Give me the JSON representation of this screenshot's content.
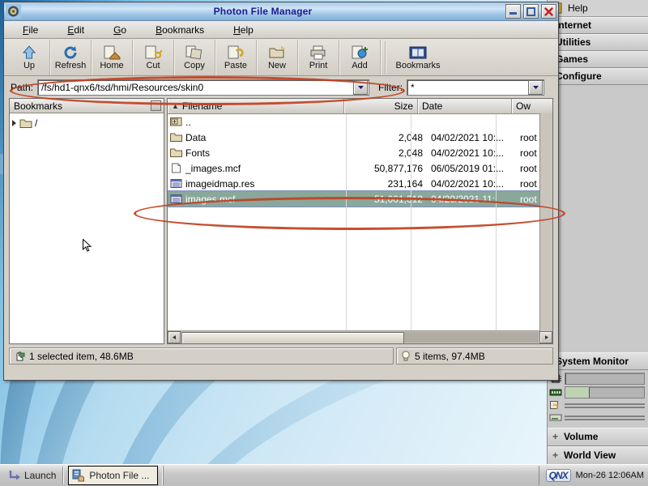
{
  "desktop": {
    "taskbar": {
      "launch_label": "Launch",
      "task_label": "Photon File ...",
      "brand": "QNX",
      "clock": "Mon-26 12:06AM"
    },
    "shelf": {
      "help_label": "Help",
      "groups": [
        "Internet",
        "Utilities",
        "Games",
        "Configure"
      ],
      "system_monitor": {
        "title": "System Monitor",
        "gauges": [
          {
            "icon": "cpu-icon",
            "percent": 0,
            "thin": false
          },
          {
            "icon": "memory-icon",
            "percent": 30,
            "thin": false
          },
          {
            "icon": "disk-icon",
            "percent": 0,
            "thin": true
          },
          {
            "icon": "disk-icon",
            "percent": 0,
            "thin": true
          },
          {
            "icon": "network-icon",
            "percent": 0,
            "thin": true
          },
          {
            "icon": "network-icon",
            "percent": 0,
            "thin": true
          }
        ]
      },
      "expanders": [
        "Volume",
        "World View"
      ]
    }
  },
  "window": {
    "title": "Photon File Manager",
    "controls": {
      "minimize": "minimize-button",
      "maximize": "maximize-button",
      "close": "close-button"
    },
    "menu": [
      {
        "label": "File",
        "accel": "F"
      },
      {
        "label": "Edit",
        "accel": "E"
      },
      {
        "label": "Go",
        "accel": "G"
      },
      {
        "label": "Bookmarks",
        "accel": "B"
      },
      {
        "label": "Help",
        "accel": "H"
      }
    ],
    "toolbar": [
      {
        "label": "Up",
        "icon": "up-arrow-icon"
      },
      {
        "label": "Refresh",
        "icon": "refresh-icon"
      },
      {
        "label": "Home",
        "icon": "home-icon"
      },
      {
        "label": "Cut",
        "icon": "cut-icon"
      },
      {
        "label": "Copy",
        "icon": "copy-icon"
      },
      {
        "label": "Paste",
        "icon": "paste-icon"
      },
      {
        "label": "New",
        "icon": "new-folder-icon"
      },
      {
        "label": "Print",
        "icon": "print-icon"
      },
      {
        "label": "Add",
        "icon": "add-bookmark-icon"
      },
      {
        "label": "Bookmarks",
        "icon": "bookmarks-book-icon"
      }
    ],
    "path": {
      "label": "Path:",
      "value": "/fs/hd1-qnx6/tsd/hmi/Resources/skin0"
    },
    "filter": {
      "label": "Filter:",
      "value": "*"
    },
    "bookmarks_pane": {
      "title": "Bookmarks",
      "root_label": "/"
    },
    "file_list": {
      "columns": [
        {
          "key": "name",
          "label": "Filename",
          "sorted": true
        },
        {
          "key": "size",
          "label": "Size"
        },
        {
          "key": "date",
          "label": "Date"
        },
        {
          "key": "owner",
          "label": "Ow"
        }
      ],
      "rows": [
        {
          "name": "..",
          "icon": "parent-folder-icon",
          "size": "",
          "date": "",
          "owner": "",
          "selected": false
        },
        {
          "name": "Data",
          "icon": "folder-icon",
          "size": "2,048",
          "date": "04/02/2021 10:...",
          "owner": "root",
          "selected": false
        },
        {
          "name": "Fonts",
          "icon": "folder-icon",
          "size": "2,048",
          "date": "04/02/2021 10:...",
          "owner": "root",
          "selected": false
        },
        {
          "name": "_images.mcf",
          "icon": "file-icon",
          "size": "50,877,176",
          "date": "06/05/2019 01:...",
          "owner": "root",
          "selected": false
        },
        {
          "name": "imageidmap.res",
          "icon": "resource-file-icon",
          "size": "231,164",
          "date": "04/02/2021 10:...",
          "owner": "root",
          "selected": false
        },
        {
          "name": "images.mcf",
          "icon": "resource-file-icon",
          "size": "51,001,312",
          "date": "04/20/2021 11:...",
          "owner": "root",
          "selected": true
        }
      ]
    },
    "status": {
      "left": "1 selected item, 48.6MB",
      "right": "5 items, 97.4MB"
    }
  },
  "annotations": {
    "color": "#c1401f",
    "regions": [
      "path-field-highlight",
      "selected-row-highlight"
    ]
  }
}
